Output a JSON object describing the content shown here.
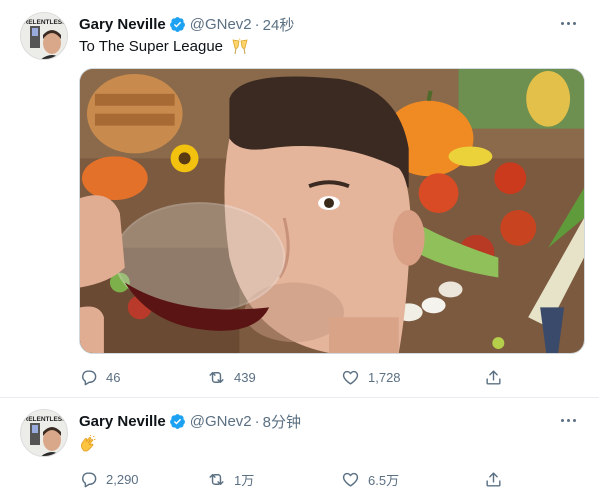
{
  "colors": {
    "link": "#1da1f2",
    "secondary": "#5b7083",
    "text": "#0f1419",
    "divider": "#e6ecf0"
  },
  "tweets": [
    {
      "author_name": "Gary Neville",
      "handle": "@GNev2",
      "separator": "·",
      "time": "24秒",
      "text": "To The Super League",
      "emoji": "clinking-glasses",
      "avatar_text": "RELENTLESS",
      "media_description": "photo",
      "stats": {
        "replies": "46",
        "retweets": "439",
        "likes": "1,728"
      }
    },
    {
      "author_name": "Gary Neville",
      "handle": "@GNev2",
      "separator": "·",
      "time": "8分钟",
      "text": "",
      "emoji": "clapping-hands",
      "avatar_text": "RELENTLESS",
      "stats": {
        "replies": "2,290",
        "retweets": "1万",
        "likes": "6.5万"
      }
    }
  ]
}
